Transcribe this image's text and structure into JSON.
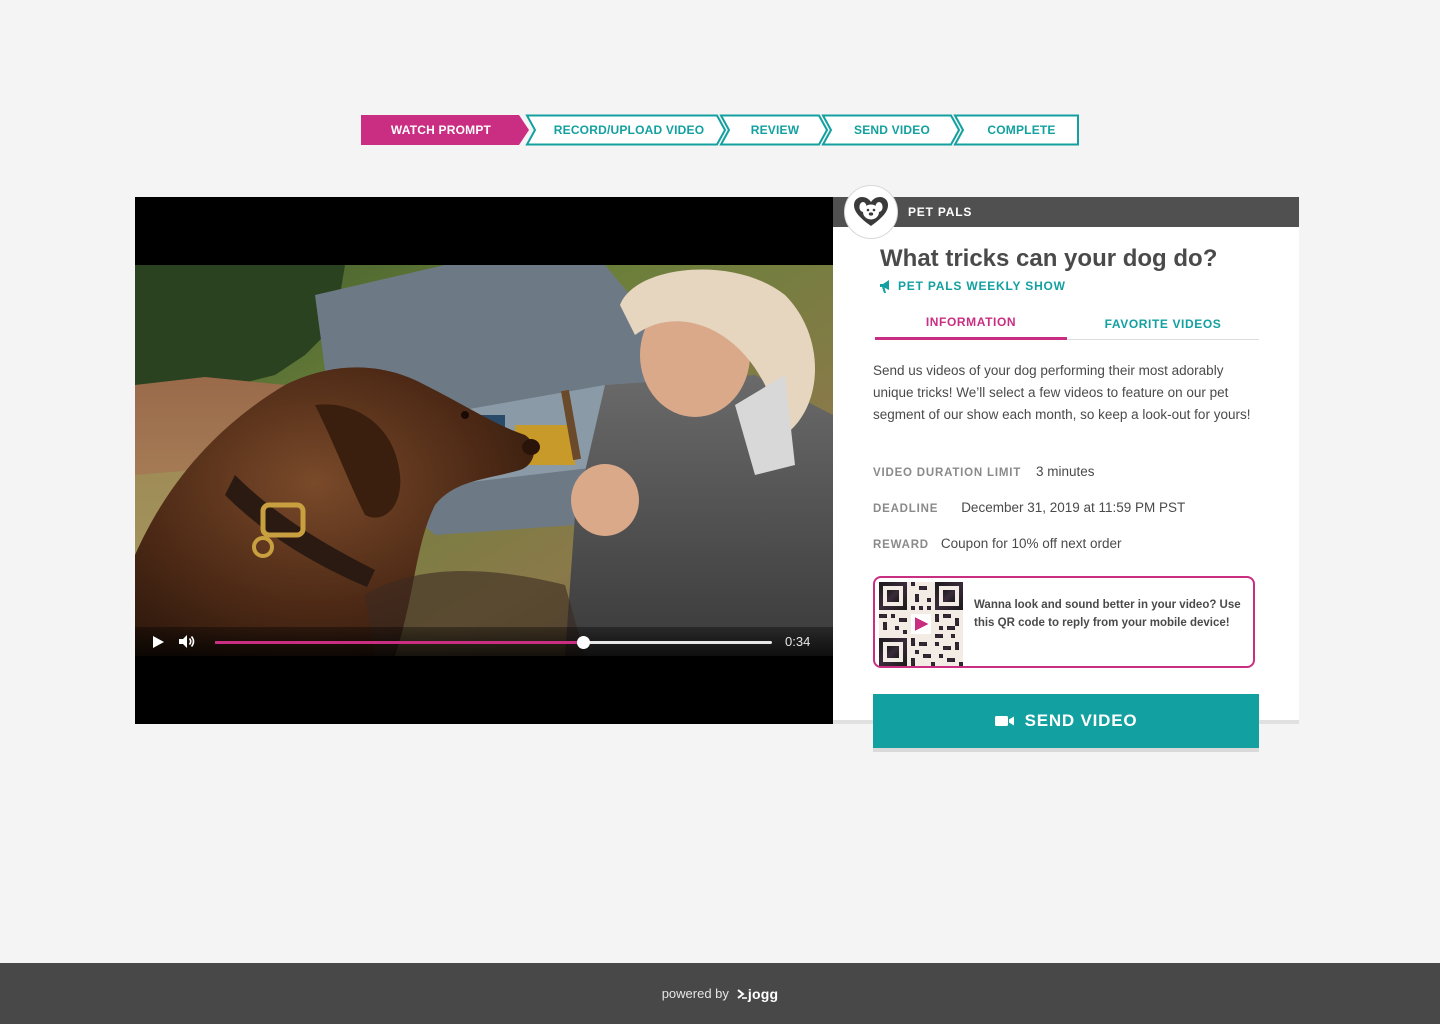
{
  "stepper": {
    "steps": [
      {
        "label": "WATCH PROMPT",
        "active": true
      },
      {
        "label": "RECORD/UPLOAD VIDEO",
        "active": false
      },
      {
        "label": "REVIEW",
        "active": false
      },
      {
        "label": "SEND VIDEO",
        "active": false
      },
      {
        "label": "COMPLETE",
        "active": false
      }
    ],
    "active_color": "#c92e82",
    "inactive_color": "#13a0a0"
  },
  "player": {
    "time": "0:34",
    "progress_fraction": 0.66,
    "play_icon": "play-icon",
    "volume_icon": "volume-icon"
  },
  "info": {
    "brand": "PET PALS",
    "brand_logo_icon": "pet-pals-logo-icon",
    "title": "What tricks can your dog do?",
    "show": "PET PALS WEEKLY SHOW",
    "tabs": [
      {
        "label": "INFORMATION",
        "active": true
      },
      {
        "label": "FAVORITE VIDEOS",
        "active": false
      }
    ],
    "description": "Send us videos of your dog performing their most adorably unique tricks! We’ll select a few videos to feature on our pet segment of our show each month, so keep a look-out for yours!",
    "meta": [
      {
        "key": "VIDEO DURATION LIMIT",
        "value": "3 minutes"
      },
      {
        "key": "DEADLINE",
        "value": "December 31, 2019 at 11:59 PM PST"
      },
      {
        "key": "REWARD",
        "value": "Coupon for 10% off next order"
      }
    ],
    "qr_text": "Wanna look and sound better in your video? Use this QR code to reply from your mobile device!",
    "send_button": "SEND VIDEO",
    "accent_pink": "#c92e82",
    "accent_teal": "#13a0a0"
  },
  "footer": {
    "powered_by": "powered by",
    "logo_text": "jogg"
  }
}
